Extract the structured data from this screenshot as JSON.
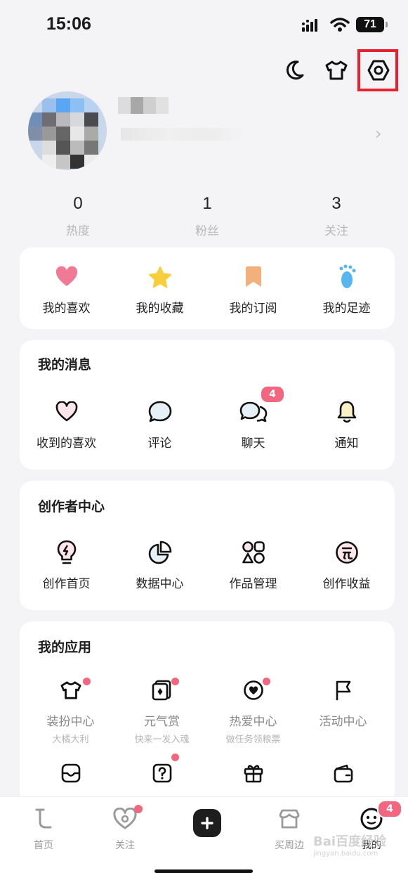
{
  "status_bar": {
    "time": "15:06",
    "battery": "71"
  },
  "top_icons": [
    "moon-icon",
    "tshirt-icon",
    "settings-hexagon-icon"
  ],
  "stats": [
    {
      "value": "0",
      "label": "热度"
    },
    {
      "value": "1",
      "label": "粉丝"
    },
    {
      "value": "3",
      "label": "关注"
    }
  ],
  "quick_links": [
    {
      "label": "我的喜欢",
      "icon": "heart-icon",
      "color": "#f07a95"
    },
    {
      "label": "我的收藏",
      "icon": "star-icon",
      "color": "#f6cf3a"
    },
    {
      "label": "我的订阅",
      "icon": "bookmark-icon",
      "color": "#f2b07c"
    },
    {
      "label": "我的足迹",
      "icon": "footprint-icon",
      "color": "#57b6ef"
    }
  ],
  "messages": {
    "title": "我的消息",
    "items": [
      {
        "label": "收到的喜欢",
        "icon": "heart-outline-icon"
      },
      {
        "label": "评论",
        "icon": "comment-icon"
      },
      {
        "label": "聊天",
        "icon": "chat-icon",
        "badge": "4"
      },
      {
        "label": "通知",
        "icon": "bell-icon"
      }
    ]
  },
  "creator": {
    "title": "创作者中心",
    "items": [
      {
        "label": "创作首页",
        "icon": "lightbulb-icon"
      },
      {
        "label": "数据中心",
        "icon": "pie-chart-icon"
      },
      {
        "label": "作品管理",
        "icon": "shapes-icon"
      },
      {
        "label": "创作收益",
        "icon": "yuan-coin-icon"
      }
    ]
  },
  "apps": {
    "title": "我的应用",
    "items": [
      {
        "label": "装扮中心",
        "sub": "大橘大利",
        "icon": "tshirt-icon"
      },
      {
        "label": "元气赏",
        "sub": "快来一发入魂",
        "icon": "cards-icon"
      },
      {
        "label": "热爱中心",
        "sub": "做任务领粮票",
        "icon": "heart-badge-icon"
      },
      {
        "label": "活动中心",
        "sub": "",
        "icon": "flag-icon"
      }
    ],
    "row2_icons": [
      "inbox-icon",
      "question-icon",
      "gift-icon",
      "wallet-icon"
    ]
  },
  "bottom_nav": [
    {
      "label": "首页",
      "icon": "home-icon"
    },
    {
      "label": "关注",
      "icon": "follow-heart-icon"
    },
    {
      "label": "买周边",
      "icon": "shop-icon"
    },
    {
      "label": "我的",
      "icon": "profile-face-icon",
      "badge": "4"
    }
  ],
  "accent_color": "#f3667f",
  "watermark": {
    "brand": "Bai百度经验",
    "url": "jingyan.baidu.com"
  }
}
